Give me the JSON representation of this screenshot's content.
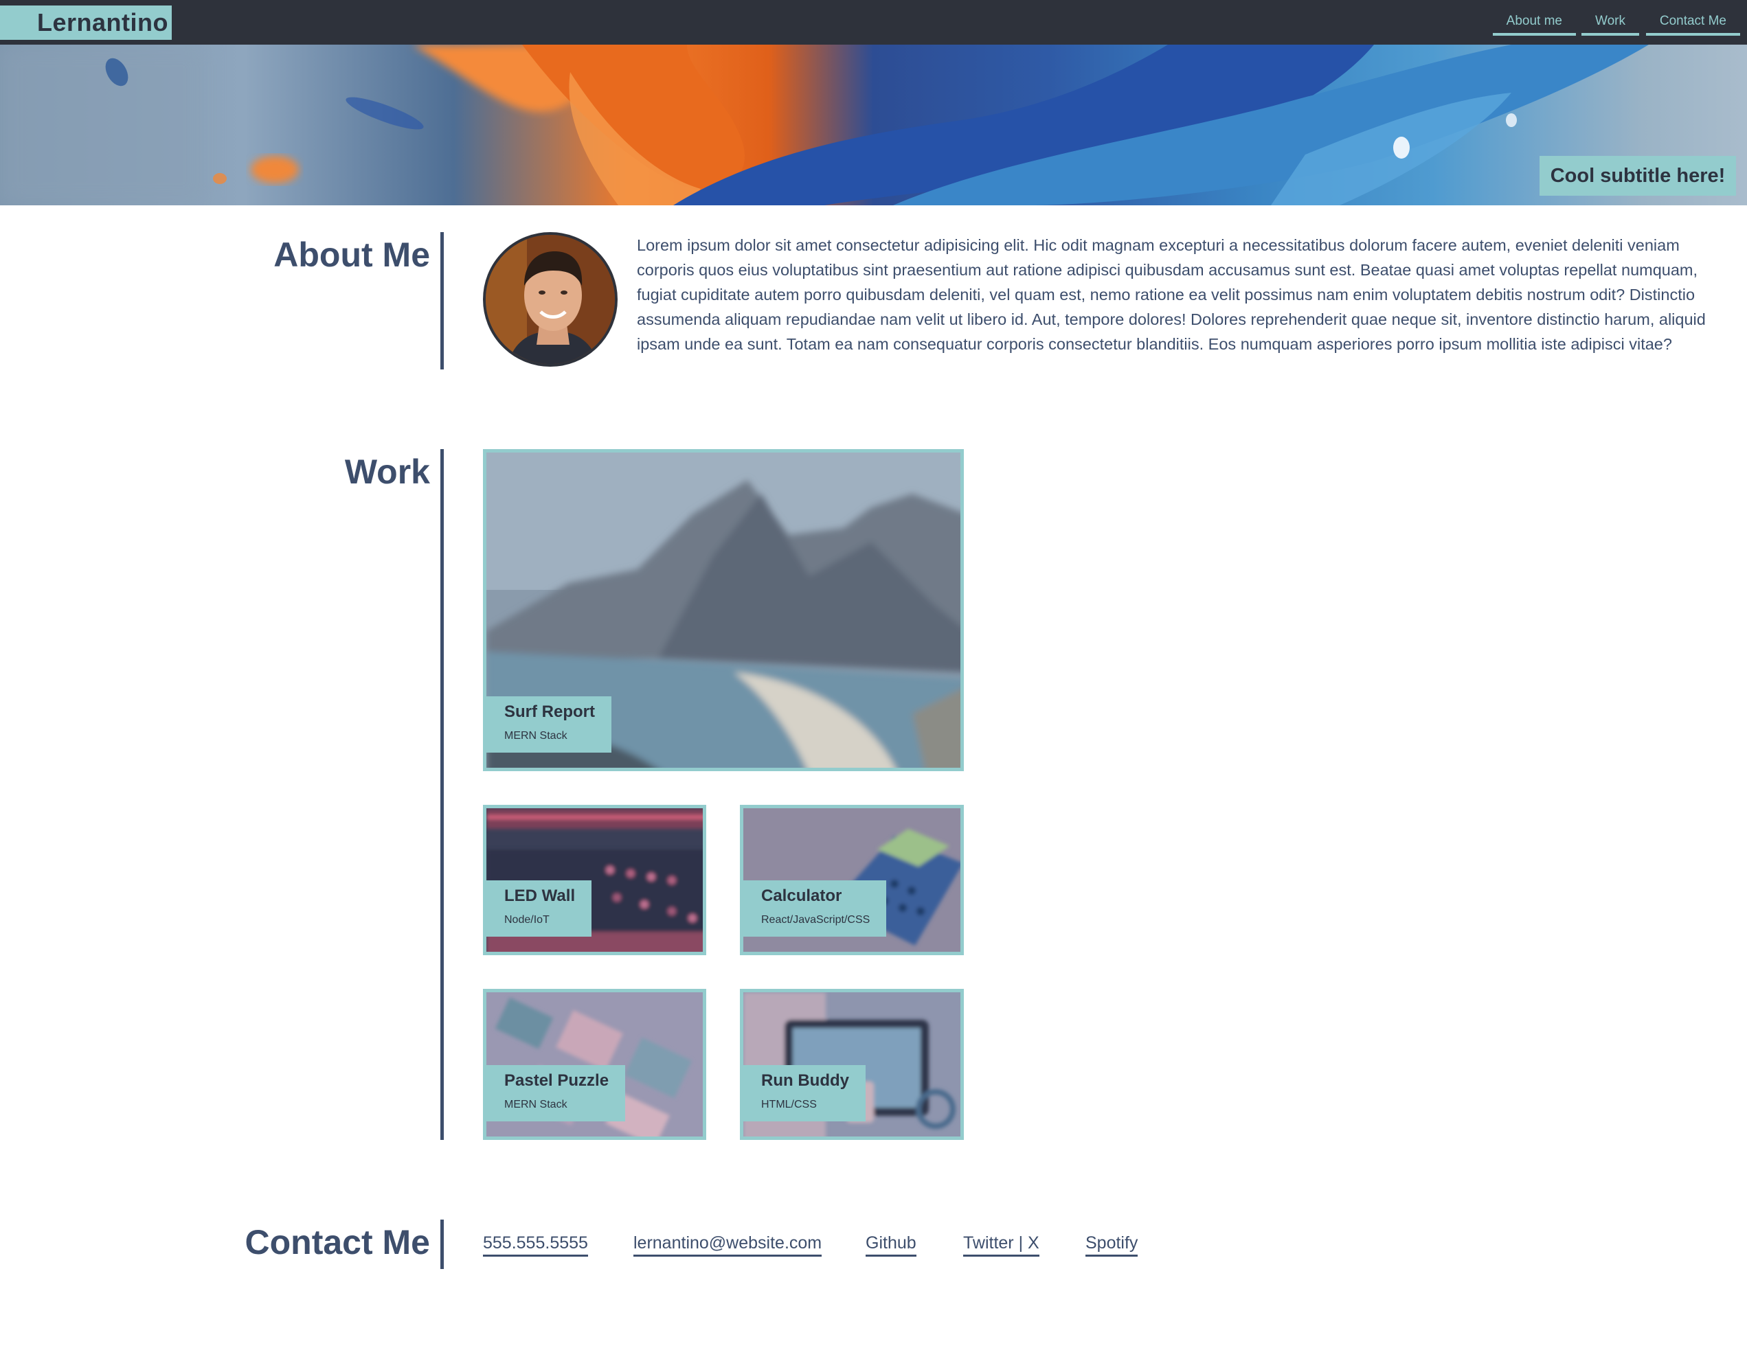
{
  "nav": {
    "brand": "Lernantino",
    "links": [
      {
        "label": "About me"
      },
      {
        "label": "Work"
      },
      {
        "label": "Contact Me"
      }
    ]
  },
  "hero": {
    "subtitle": "Cool subtitle here!"
  },
  "about": {
    "title": "About Me",
    "text": "Lorem ipsum dolor sit amet consectetur adipisicing elit. Hic odit magnam excepturi a necessitatibus dolorum facere autem, eveniet deleniti veniam corporis quos eius voluptatibus sint praesentium aut ratione adipisci quibusdam accusamus sunt est. Beatae quasi amet voluptas repellat numquam, fugiat cupiditate autem porro quibusdam deleniti, vel quam est, nemo ratione ea velit possimus nam enim voluptatem debitis nostrum odit? Distinctio assumenda aliquam repudiandae nam velit ut libero id. Aut, tempore dolores! Dolores reprehenderit quae neque sit, inventore distinctio harum, aliquid ipsam unde ea sunt. Totam ea nam consequatur corporis consectetur blanditiis. Eos numquam asperiores porro ipsum mollitia iste adipisci vitae?"
  },
  "work": {
    "title": "Work",
    "projects": [
      {
        "title": "Surf Report",
        "stack": "MERN Stack"
      },
      {
        "title": "LED Wall",
        "stack": "Node/IoT"
      },
      {
        "title": "Calculator",
        "stack": "React/JavaScript/CSS"
      },
      {
        "title": "Pastel Puzzle",
        "stack": "MERN Stack"
      },
      {
        "title": "Run Buddy",
        "stack": "HTML/CSS"
      }
    ]
  },
  "contact": {
    "title": "Contact Me",
    "links": [
      {
        "label": "555.555.5555"
      },
      {
        "label": "lernantino@website.com"
      },
      {
        "label": "Github"
      },
      {
        "label": "Twitter | X"
      },
      {
        "label": "Spotify"
      }
    ]
  },
  "colors": {
    "accent": "#93cccd",
    "dark": "#2e323b",
    "text": "#3d4e6c"
  }
}
